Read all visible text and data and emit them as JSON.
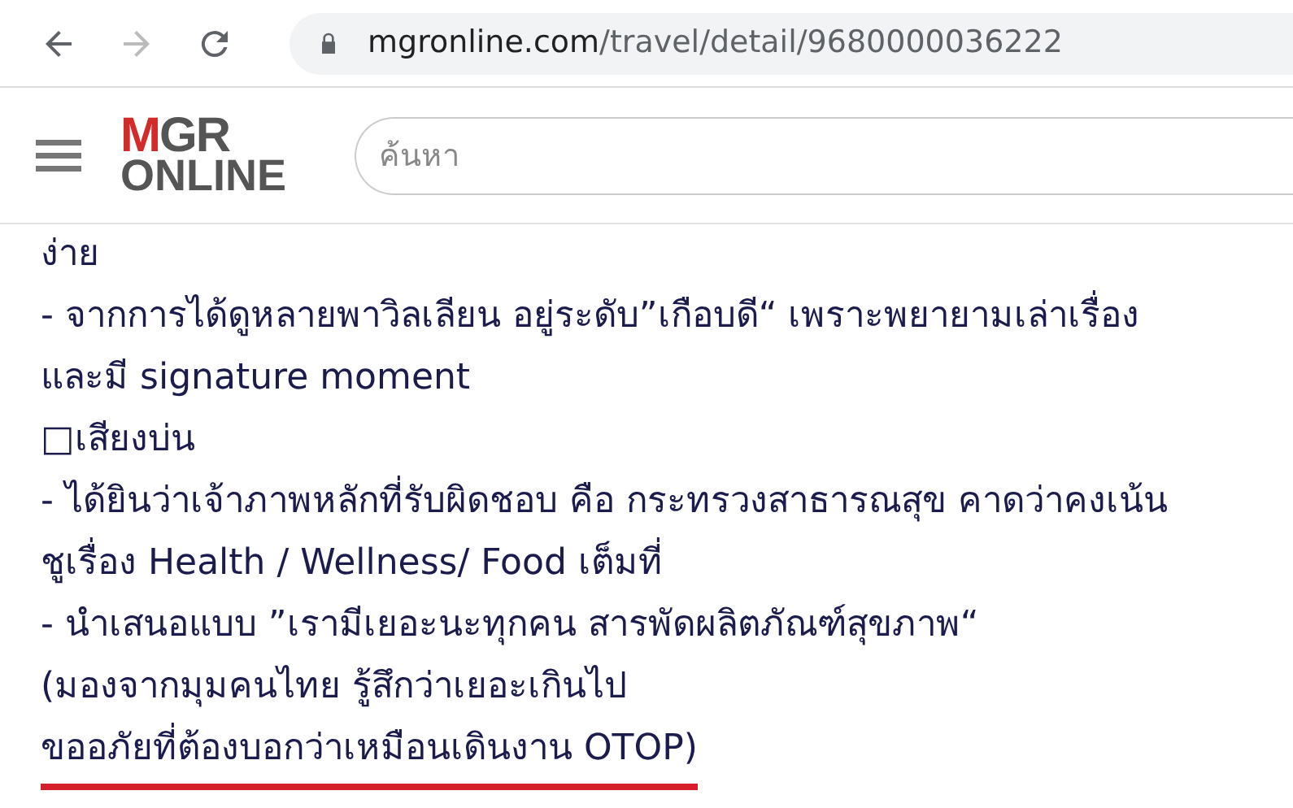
{
  "browser": {
    "url_host": "mgronline.com",
    "url_path": "/travel/detail/9680000036222",
    "back_disabled": false,
    "forward_disabled": true
  },
  "header": {
    "logo_top": "MGR",
    "logo_bottom": "ONLINE",
    "search": {
      "placeholder": "ค้นหา"
    }
  },
  "article_lines": [
    {
      "text": "ง่าย",
      "underlined": false
    },
    {
      "text": "- จากการได้ดูหลายพาวิลเลียน อยู่ระดับ”เกือบดี“ เพราะพยายามเล่าเรื่อง",
      "underlined": false
    },
    {
      "text": "และมี signature moment",
      "underlined": false
    },
    {
      "text": "□เสียงบ่น",
      "underlined": false
    },
    {
      "text": "- ได้ยินว่าเจ้าภาพหลักที่รับผิดชอบ คือ กระทรวงสาธารณสุข คาดว่าคงเน้น",
      "underlined": false
    },
    {
      "text": "ชูเรื่อง Health / Wellness/ Food เต็มที่",
      "underlined": false
    },
    {
      "text": "- นำเสนอแบบ ”เรามีเยอะนะทุกคน สารพัดผลิตภัณฑ์สุขภาพ“",
      "underlined": false
    },
    {
      "text": "(มองจากมุมคนไทย รู้สึกว่าเยอะเกินไป",
      "underlined": false
    },
    {
      "text": "ขออภัยที่ต้องบอกว่าเหมือนเดินงาน OTOP)",
      "underlined": true
    }
  ]
}
